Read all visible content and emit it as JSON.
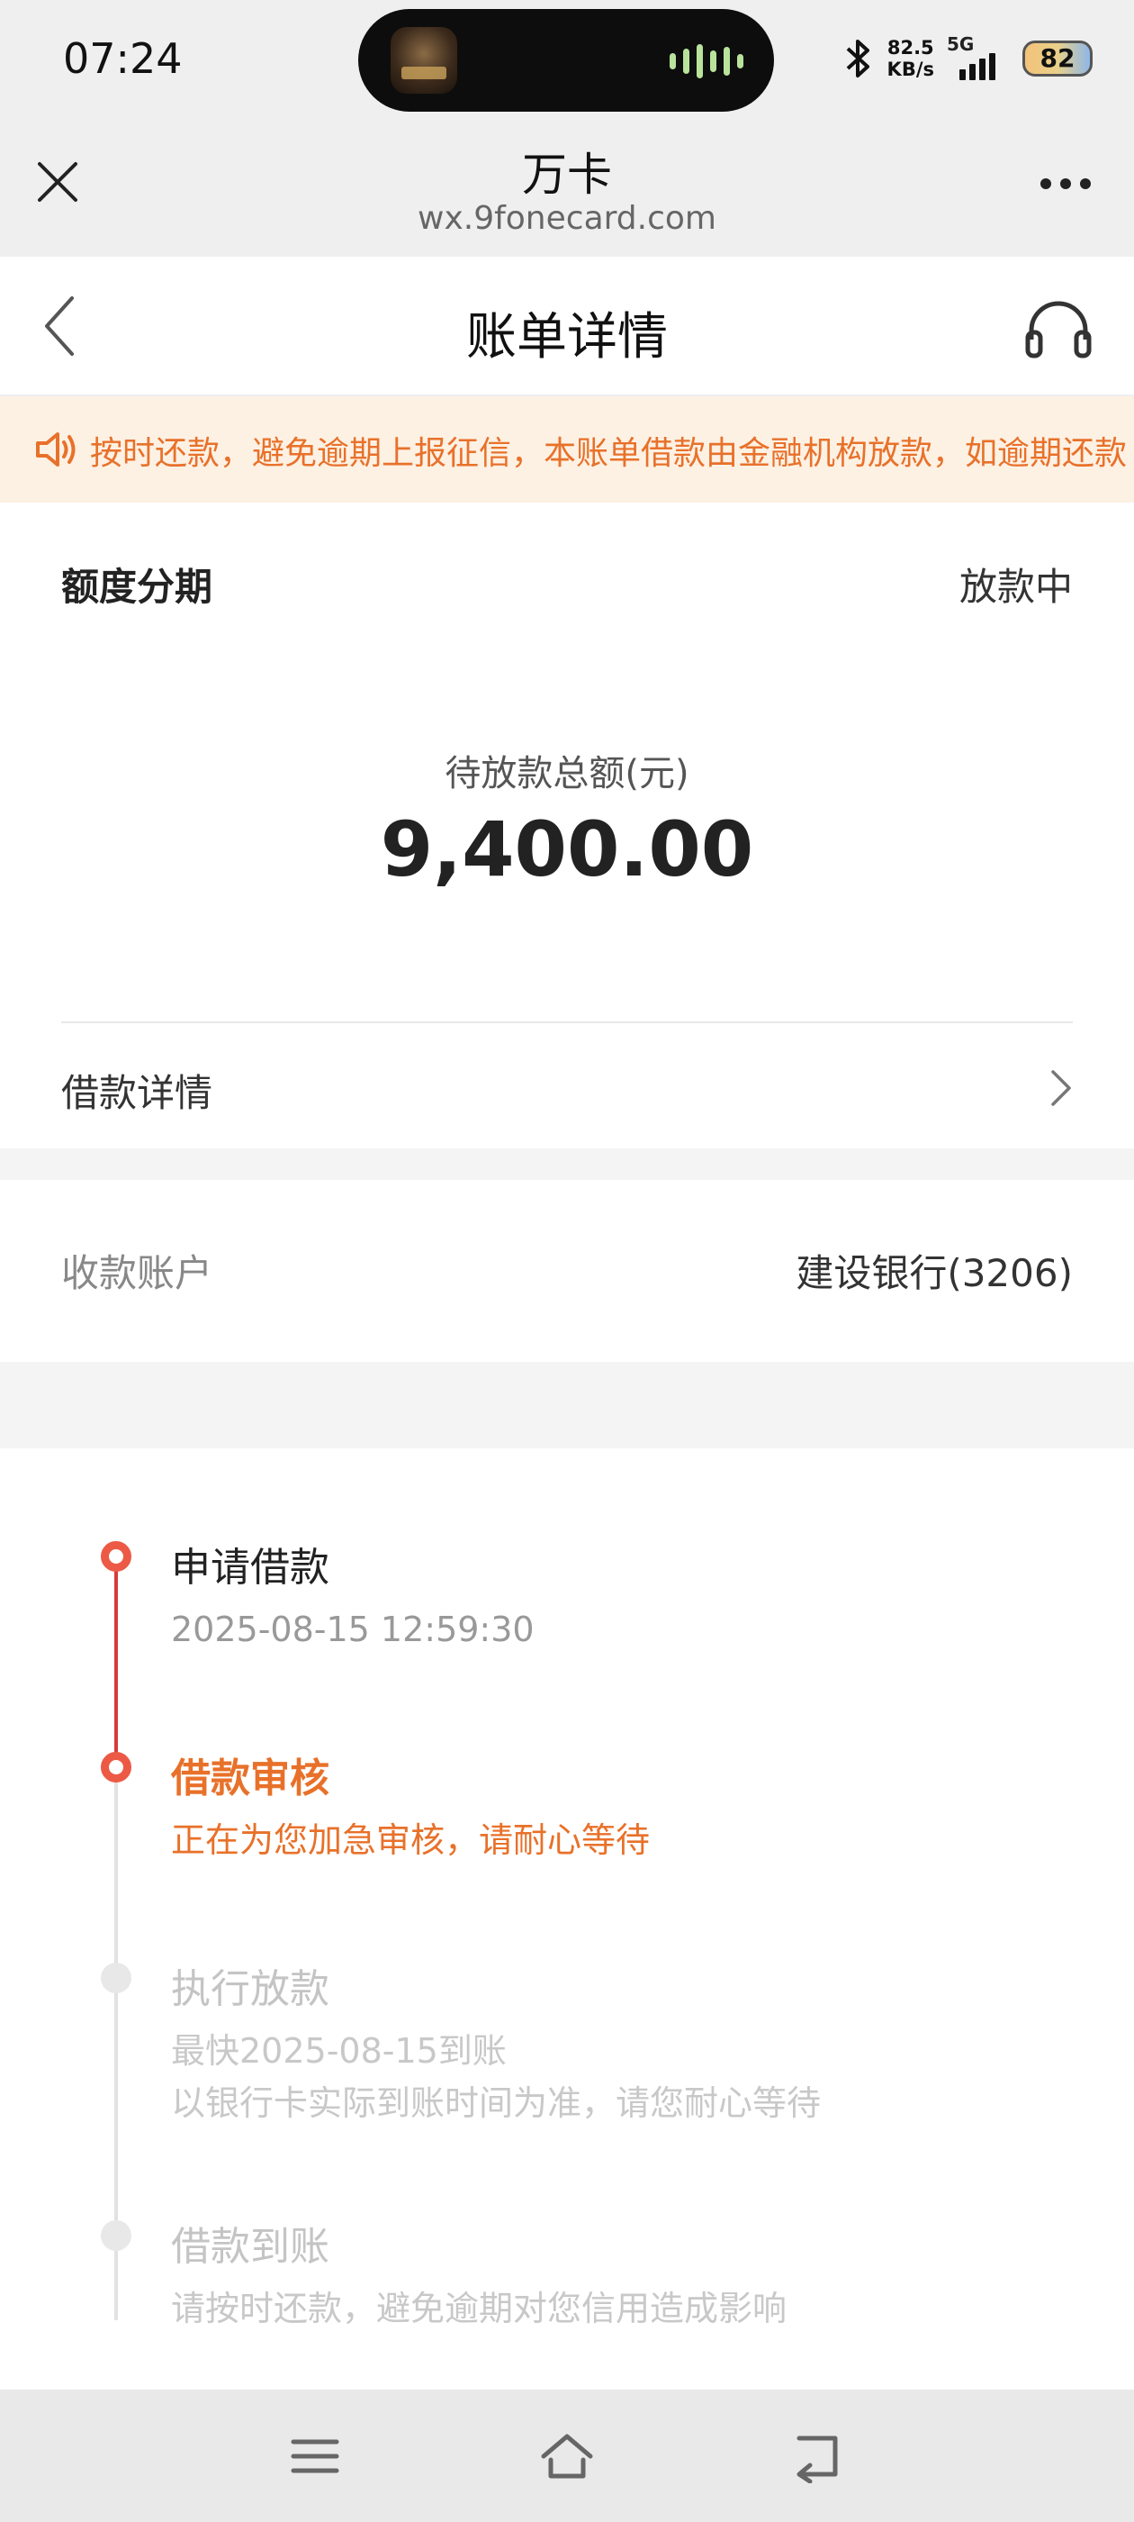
{
  "status_bar": {
    "time": "07:24",
    "speed_value": "82.5",
    "speed_unit": "KB/s",
    "network": "5G",
    "battery": "82",
    "icons": [
      "bluetooth-icon",
      "signal-icon",
      "battery-icon",
      "audio-wave-icon"
    ]
  },
  "browser": {
    "title": "万卡",
    "url": "wx.9fonecard.com"
  },
  "nav": {
    "title": "账单详情"
  },
  "notice": {
    "text": "按时还款，避免逾期上报征信，本账单借款由金融机构放款，如逾期还款"
  },
  "summary": {
    "product": "额度分期",
    "status": "放款中",
    "amount_label": "待放款总额(元)",
    "amount": "9,400.00",
    "loan_detail_label": "借款详情"
  },
  "account": {
    "label": "收款账户",
    "value": "建设银行(3206)"
  },
  "timeline": [
    {
      "title": "申请借款",
      "sub": [
        "2025-08-15 12:59:30"
      ],
      "state": "done"
    },
    {
      "title": "借款审核",
      "sub": [
        "正在为您加急审核，请耐心等待"
      ],
      "state": "current"
    },
    {
      "title": "执行放款",
      "sub": [
        "最快2025-08-15到账",
        "以银行卡实际到账时间为准，请您耐心等待"
      ],
      "state": "pending"
    },
    {
      "title": "借款到账",
      "sub": [
        "请按时还款，避免逾期对您信用造成影响"
      ],
      "state": "pending"
    }
  ],
  "colors": {
    "accent": "#e8712a",
    "timeline_dot": "#ec5a45",
    "timeline_line": "#d93a3a",
    "notice_bg": "#fdf1e4"
  }
}
